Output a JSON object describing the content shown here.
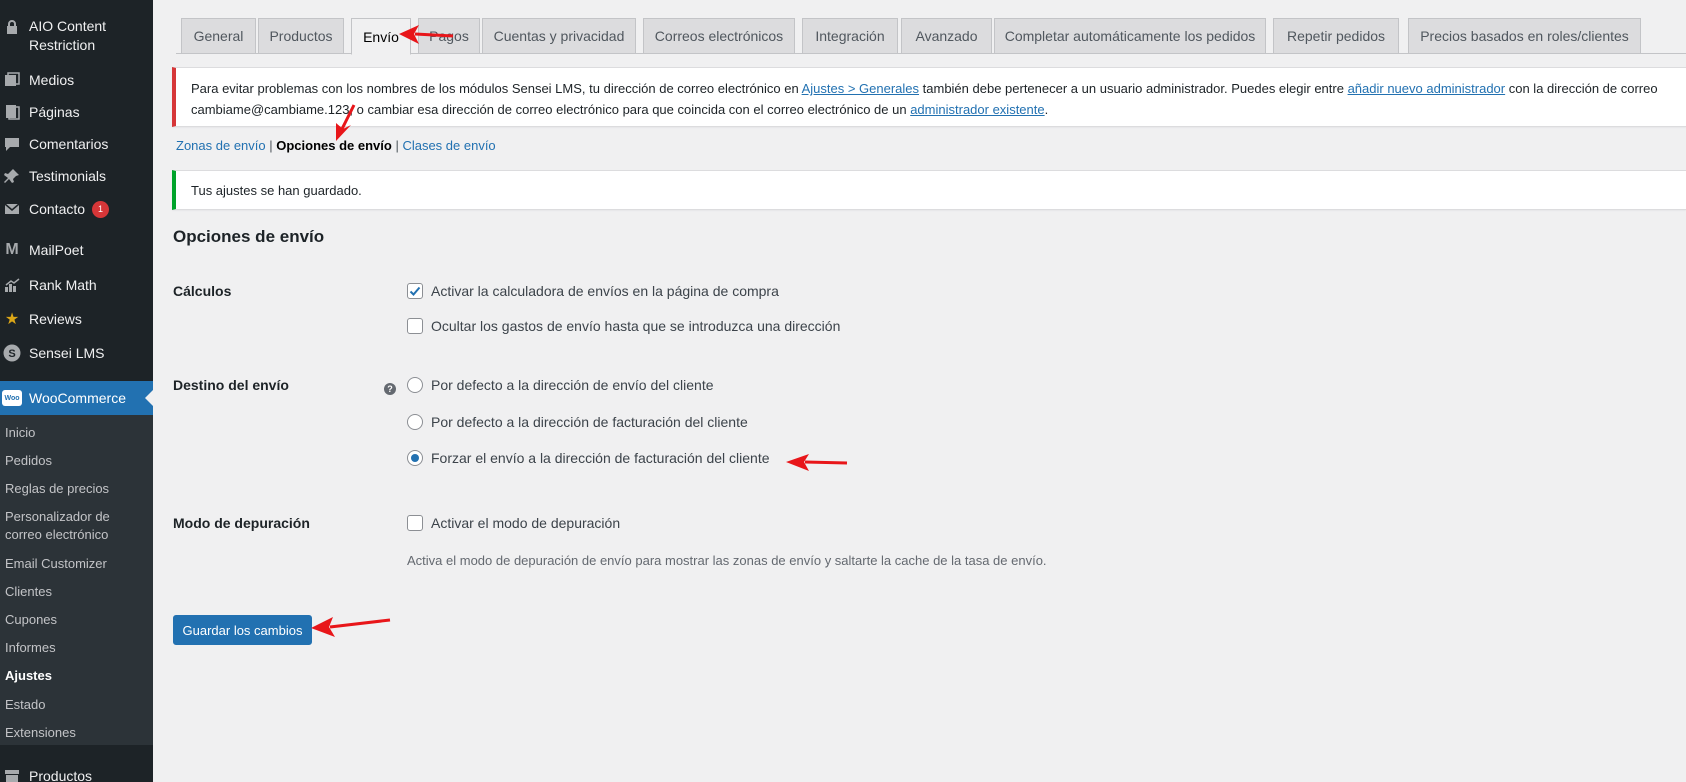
{
  "sidebar": {
    "items": [
      {
        "label": "AIO Content Restriction",
        "icon": "lock-icon"
      },
      {
        "label": "Medios",
        "icon": "media-icon"
      },
      {
        "label": "Páginas",
        "icon": "pages-icon"
      },
      {
        "label": "Comentarios",
        "icon": "comments-icon"
      },
      {
        "label": "Testimonials",
        "icon": "pin-icon"
      },
      {
        "label": "Contacto",
        "icon": "mail-icon",
        "badge": "1"
      },
      {
        "label": "MailPoet",
        "icon": "mailpoet-icon"
      },
      {
        "label": "Rank Math",
        "icon": "chart-icon"
      },
      {
        "label": "Reviews",
        "icon": "star-icon"
      },
      {
        "label": "Sensei LMS",
        "icon": "sensei-icon"
      }
    ],
    "woocommerce": {
      "label": "WooCommerce",
      "logo": "Woo"
    },
    "submenu": [
      "Inicio",
      "Pedidos",
      "Reglas de precios",
      "Personalizador de correo electrónico",
      "Email Customizer",
      "Clientes",
      "Cupones",
      "Informes",
      "Ajustes",
      "Estado",
      "Extensiones"
    ],
    "productos": {
      "label": "Productos",
      "icon": "archive-icon"
    }
  },
  "tabs": [
    "General",
    "Productos",
    "Envío",
    "Pagos",
    "Cuentas y privacidad",
    "Correos electrónicos",
    "Integración",
    "Avanzado",
    "Completar automáticamente los pedidos",
    "Repetir pedidos",
    "Precios basados en roles/clientes"
  ],
  "notice_error": {
    "part1": "Para evitar problemas con los nombres de los módulos Sensei LMS, tu dirección de correo electrónico en ",
    "link1": "Ajustes > Generales",
    "part2": " también debe pertenecer a un usuario administrador. Puedes elegir entre ",
    "link2": "añadir nuevo administrador",
    "part3": " con la dirección de correo",
    "line2_part1": "cambiame@cambiame.123, o cambiar esa dirección de correo electrónico para que coincida con el correo electrónico de un ",
    "link3": "administrador existente",
    "line2_end": "."
  },
  "subnav": {
    "zones": "Zonas de envío",
    "sep": " | ",
    "options": "Opciones de envío",
    "classes": "Clases de envío"
  },
  "notice_success": "Tus ajustes se han guardado.",
  "section_title": "Opciones de envío",
  "calculos": {
    "label": "Cálculos",
    "opt1": "Activar la calculadora de envíos en la página de compra",
    "opt1_checked": true,
    "opt2": "Ocultar los gastos de envío hasta que se introduzca una dirección",
    "opt2_checked": false
  },
  "destino": {
    "label": "Destino del envío",
    "help": "?",
    "opt1": "Por defecto a la dirección de envío del cliente",
    "opt2": "Por defecto a la dirección de facturación del cliente",
    "opt3": "Forzar el envío a la dirección de facturación del cliente",
    "selected": 3
  },
  "debug": {
    "label": "Modo de depuración",
    "opt": "Activar el modo de depuración",
    "checked": false,
    "description": "Activa el modo de depuración de envío para mostrar las zonas de envío y saltarte la cache de la tasa de envío."
  },
  "save_button": "Guardar los cambios",
  "colors": {
    "sidebar_bg": "#1d2327",
    "accent": "#2271b1",
    "error": "#d63638",
    "success": "#00a32a",
    "annotation_arrow": "#e8161a"
  }
}
